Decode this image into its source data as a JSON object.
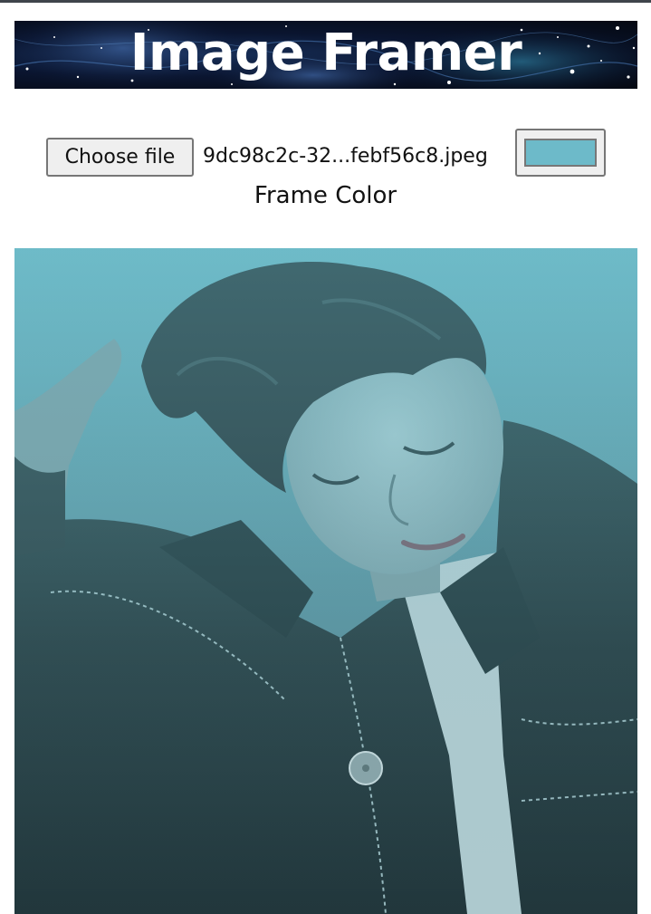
{
  "app": {
    "title": "Image Framer"
  },
  "controls": {
    "choose_file_label": "Choose file",
    "file_name": "9dc98c2c-32...febf56c8.jpeg",
    "frame_color_value": "#6dbac9",
    "frame_color_label": "Frame Color"
  },
  "photo": {
    "description_icon": "portrait-photo",
    "frame_color": "#6dbac9"
  }
}
